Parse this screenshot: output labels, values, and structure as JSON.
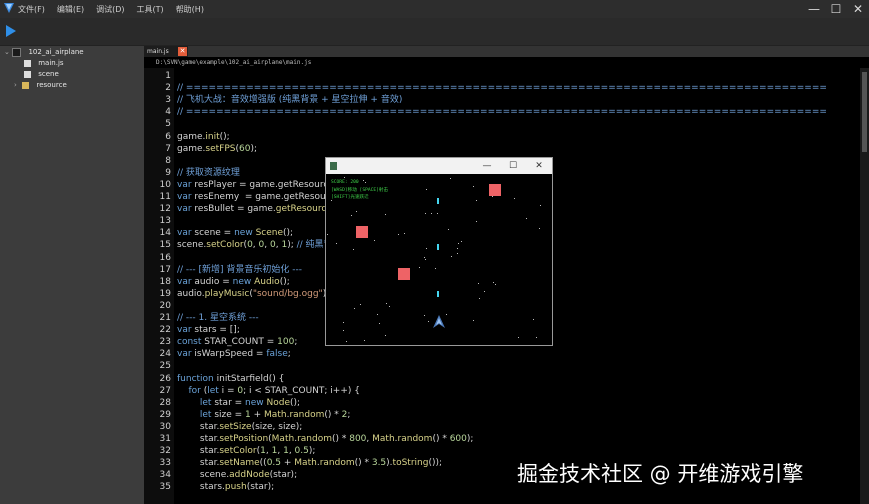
{
  "menu": [
    "文件(F)",
    "编辑(E)",
    "调试(D)",
    "工具(T)",
    "帮助(H)"
  ],
  "window_controls": {
    "minimize": "—",
    "maximize": "☐",
    "close": "✕"
  },
  "project_tree": {
    "root": "102_ai_airplane",
    "items": [
      "main.js",
      "scene",
      "resource"
    ]
  },
  "editor": {
    "tab_label": "main.js",
    "tab_close": "✕",
    "file_path": "D:\\SVN\\game\\example\\102_ai_airplane\\main.js"
  },
  "code_lines": [
    {
      "n": "1",
      "t": ""
    },
    {
      "n": "2",
      "t": "// ====================================================================================="
    },
    {
      "n": "3",
      "t": "// 飞机大战：音效增强版 (纯黑背景 + 星空拉伸 + 音效)"
    },
    {
      "n": "4",
      "t": "// ====================================================================================="
    },
    {
      "n": "5",
      "t": ""
    },
    {
      "n": "6",
      "t": "game.init();"
    },
    {
      "n": "7",
      "t": "game.setFPS(60);"
    },
    {
      "n": "8",
      "t": ""
    },
    {
      "n": "9",
      "t": "// 获取资源纹理"
    },
    {
      "n": "10",
      "t": "var resPlayer = game.getResource"
    },
    {
      "n": "11",
      "t": "var resEnemy  = game.getResource"
    },
    {
      "n": "12",
      "t": "var resBullet = game.getResource("
    },
    {
      "n": "13",
      "t": ""
    },
    {
      "n": "14",
      "t": "var scene = new Scene();"
    },
    {
      "n": "15",
      "t": "scene.setColor(0, 0, 0, 1); // 纯黑背"
    },
    {
      "n": "16",
      "t": ""
    },
    {
      "n": "17",
      "t": "// --- [新增] 背景音乐初始化 ---"
    },
    {
      "n": "18",
      "t": "var audio = new Audio();"
    },
    {
      "n": "19",
      "t": "audio.playMusic(\"sound/bg.ogg\");"
    },
    {
      "n": "20",
      "t": ""
    },
    {
      "n": "21",
      "t": "// --- 1. 星空系统 ---"
    },
    {
      "n": "22",
      "t": "var stars = [];"
    },
    {
      "n": "23",
      "t": "const STAR_COUNT = 100;"
    },
    {
      "n": "24",
      "t": "var isWarpSpeed = false;"
    },
    {
      "n": "25",
      "t": ""
    },
    {
      "n": "26",
      "t": "function initStarfield() {"
    },
    {
      "n": "27",
      "t": "    for (let i = 0; i < STAR_COUNT; i++) {"
    },
    {
      "n": "28",
      "t": "        let star = new Node();"
    },
    {
      "n": "29",
      "t": "        let size = 1 + Math.random() * 2;"
    },
    {
      "n": "30",
      "t": "        star.setSize(size, size);"
    },
    {
      "n": "31",
      "t": "        star.setPosition(Math.random() * 800, Math.random() * 600);"
    },
    {
      "n": "32",
      "t": "        star.setColor(1, 1, 1, 0.5);"
    },
    {
      "n": "33",
      "t": "        star.setName((0.5 + Math.random() * 3.5).toString());"
    },
    {
      "n": "34",
      "t": "        scene.addNode(star);"
    },
    {
      "n": "35",
      "t": "        stars.push(star);"
    }
  ],
  "game_window": {
    "window_controls": {
      "minimize": "—",
      "maximize": "☐",
      "close": "✕"
    },
    "hud": [
      "SCORE: 200",
      "[WASD]移动 [SPACE]射击",
      "[SHIFT]光速跃迁"
    ],
    "colors": {
      "enemy": "#ee6366",
      "bullet": "#45d6f0",
      "hud": "#3fd24a"
    }
  },
  "watermark": "掘金技术社区 @ 开维游戏引擎"
}
